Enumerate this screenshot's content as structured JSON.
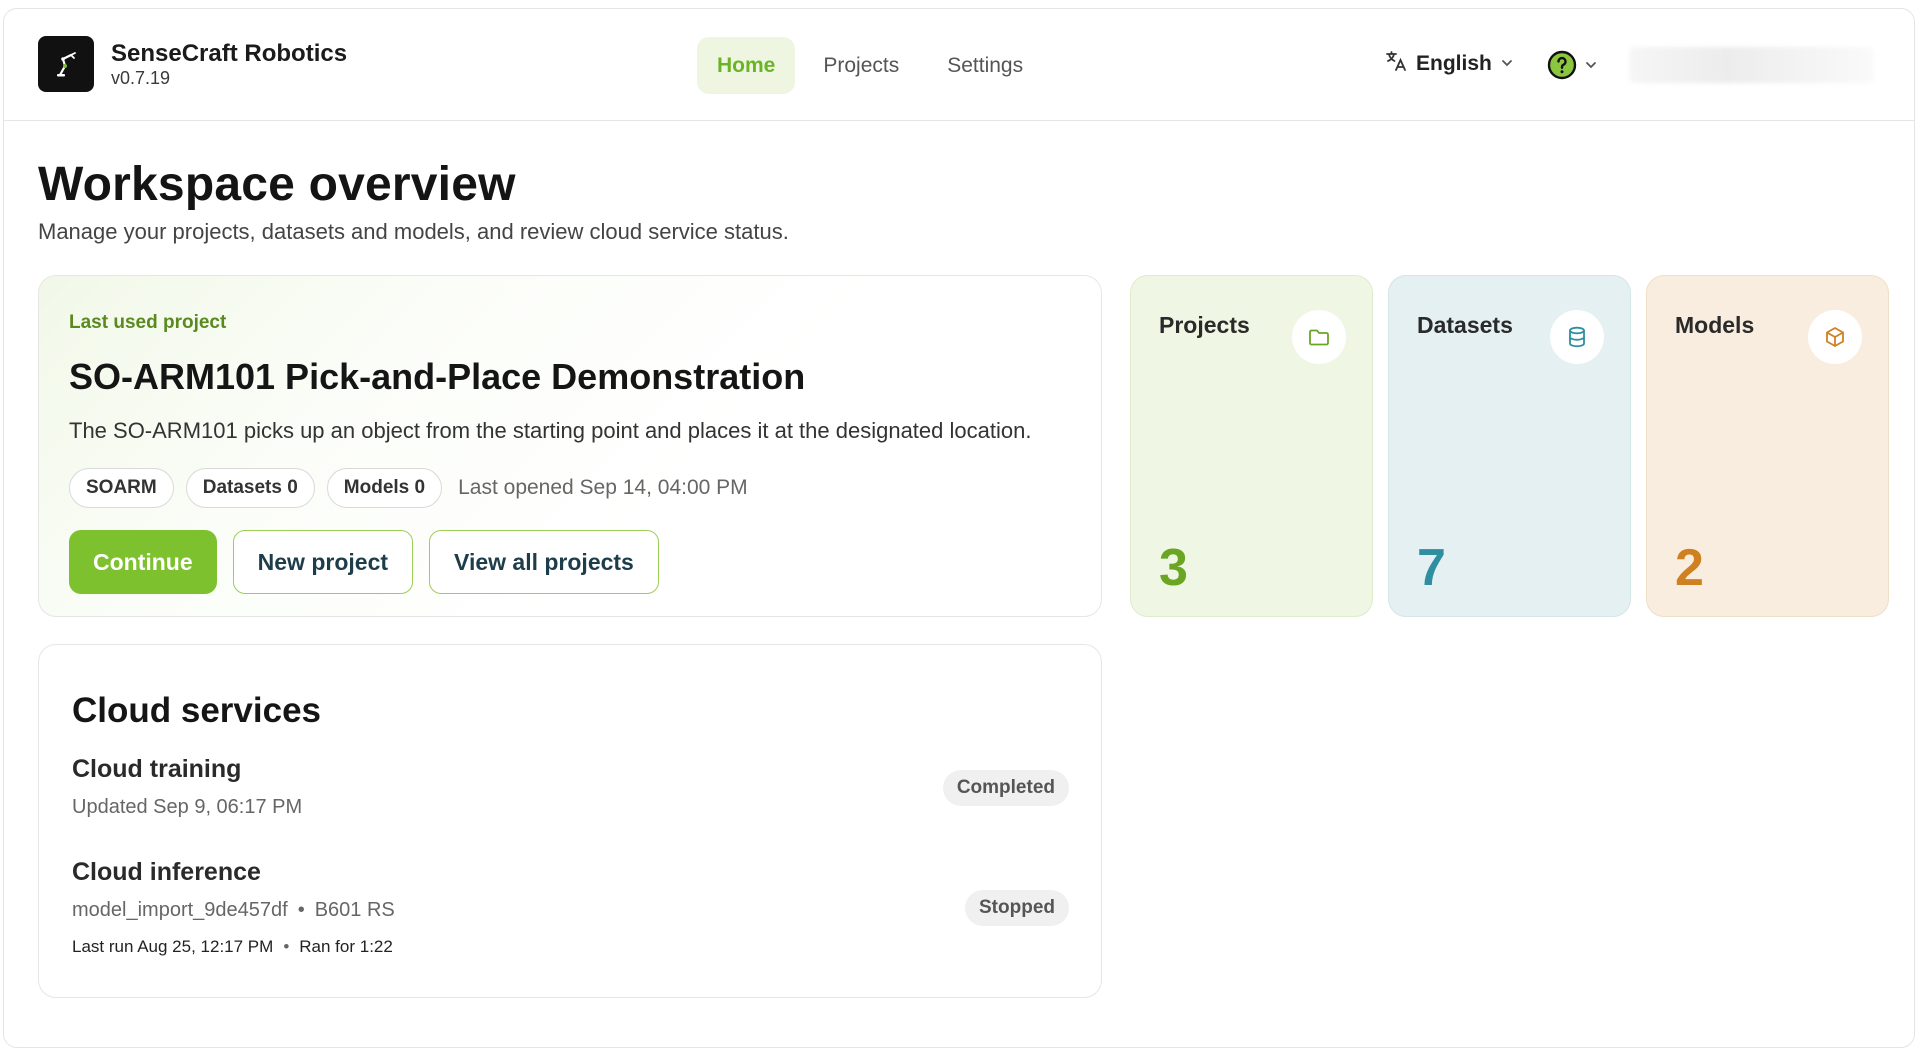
{
  "app": {
    "name": "SenseCraft Robotics",
    "version": "v0.7.19"
  },
  "nav": {
    "items": [
      {
        "label": "Home",
        "active": true
      },
      {
        "label": "Projects"
      },
      {
        "label": "Settings"
      }
    ]
  },
  "header": {
    "language": "English",
    "icons": {
      "language": "translate-icon",
      "help": "help-circle-icon",
      "chevron": "chevron-down-icon"
    }
  },
  "page": {
    "title": "Workspace overview",
    "subtitle": "Manage your projects, datasets and models, and review cloud service status."
  },
  "last_project": {
    "eyebrow": "Last used project",
    "title": "SO-ARM101 Pick-and-Place Demonstration",
    "description": "The SO-ARM101 picks up an object from the starting point and places it at the designated location.",
    "chips": [
      "SOARM",
      "Datasets 0",
      "Models 0"
    ],
    "last_opened": "Last opened Sep 14, 04:00 PM",
    "buttons": {
      "continue": "Continue",
      "new_project": "New project",
      "view_all": "View all projects"
    }
  },
  "stats": {
    "projects": {
      "label": "Projects",
      "value": "3",
      "icon": "folder-icon"
    },
    "datasets": {
      "label": "Datasets",
      "value": "7",
      "icon": "database-icon"
    },
    "models": {
      "label": "Models",
      "value": "2",
      "icon": "cube-icon"
    }
  },
  "colors": {
    "accent": "#7ec12f",
    "projects": "#6aa524",
    "datasets": "#2f8fa0",
    "models": "#cf8122"
  },
  "cloud": {
    "title": "Cloud services",
    "training": {
      "name": "Cloud training",
      "updated": "Updated Sep 9, 06:17 PM",
      "status": "Completed"
    },
    "inference": {
      "name": "Cloud inference",
      "model": "model_import_9de457df",
      "device": "B601 RS",
      "last_run": "Last run Aug 25, 12:17 PM",
      "duration": "Ran for 1:22",
      "status": "Stopped"
    }
  }
}
